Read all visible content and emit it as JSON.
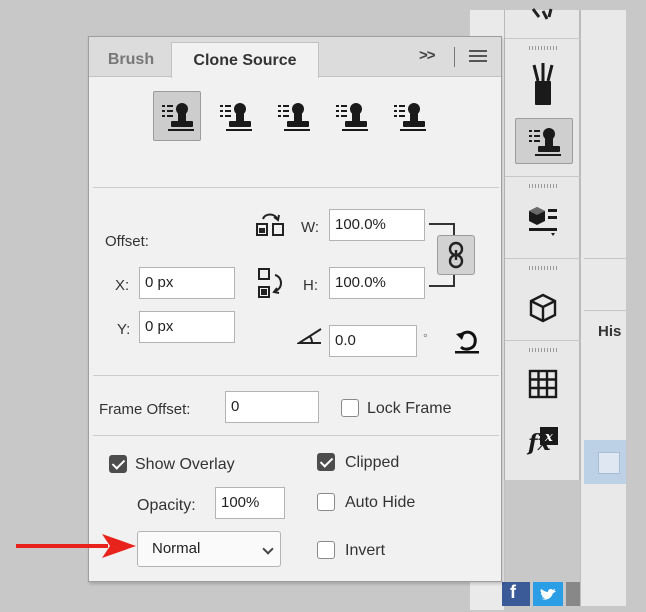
{
  "panel": {
    "tabs": [
      {
        "label": "Brush",
        "active": false
      },
      {
        "label": "Clone Source",
        "active": true
      }
    ],
    "more_label": ">>",
    "menu_icon": "panel-menu-icon",
    "clone_source_buttons": [
      {
        "icon": "clone-source-stamp-icon",
        "active": true
      },
      {
        "icon": "clone-source-stamp-icon",
        "active": false
      },
      {
        "icon": "clone-source-stamp-icon",
        "active": false
      },
      {
        "icon": "clone-source-stamp-icon",
        "active": false
      },
      {
        "icon": "clone-source-stamp-icon",
        "active": false
      }
    ],
    "offset": {
      "label": "Offset:",
      "x_label": "X:",
      "x_value": "0 px",
      "y_label": "Y:",
      "y_value": "0 px",
      "w_label": "W:",
      "w_value": "100.0%",
      "h_label": "H:",
      "h_value": "100.0%",
      "angle_value": "0.0",
      "degree_symbol": "°"
    },
    "frame_offset": {
      "label": "Frame Offset:",
      "value": "0",
      "lock_frame_label": "Lock Frame",
      "lock_frame_checked": false
    },
    "overlay": {
      "show_overlay_label": "Show Overlay",
      "show_overlay_checked": true,
      "opacity_label": "Opacity:",
      "opacity_value": "100%",
      "clipped_label": "Clipped",
      "clipped_checked": true,
      "auto_hide_label": "Auto Hide",
      "auto_hide_checked": false,
      "invert_label": "Invert",
      "invert_checked": false,
      "blend_mode": "Normal"
    }
  },
  "history": {
    "tab_label": "His"
  },
  "colors": {
    "annotation_arrow": "#e8231c",
    "history_selection": "#bcd0e6"
  }
}
